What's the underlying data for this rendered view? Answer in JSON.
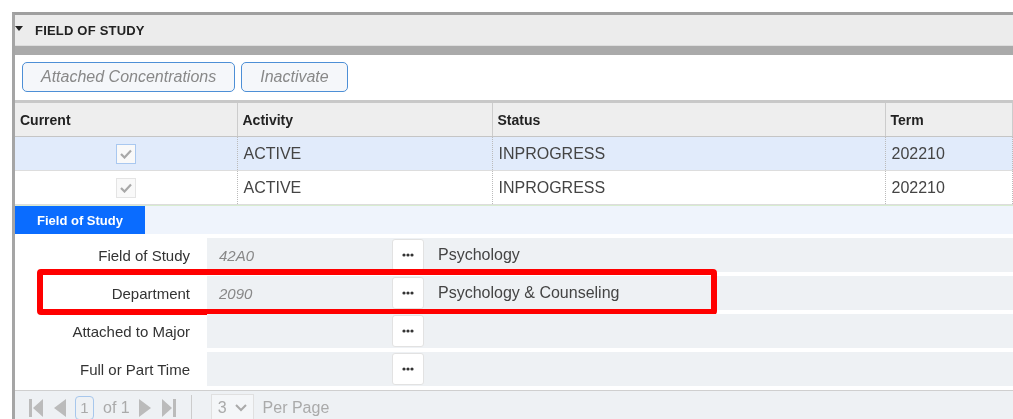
{
  "section": {
    "title": "FIELD OF STUDY",
    "expanded": true
  },
  "buttons": [
    {
      "label": "Attached Concentrations",
      "disabled": true
    },
    {
      "label": "Inactivate",
      "disabled": true
    }
  ],
  "table": {
    "columns": [
      "Current",
      "Activity",
      "Status",
      "Term"
    ],
    "rows": [
      {
        "selected": true,
        "current": true,
        "activity": "ACTIVE",
        "status": "INPROGRESS",
        "term": "202210"
      },
      {
        "selected": false,
        "current": true,
        "activity": "ACTIVE",
        "status": "INPROGRESS",
        "term": "202210"
      }
    ]
  },
  "tabs": [
    {
      "label": "Field of Study",
      "selected": true
    }
  ],
  "fields": [
    {
      "label": "Field of Study",
      "code": "42A0",
      "description": "Psychology",
      "highlighted": false
    },
    {
      "label": "Department",
      "code": "2090",
      "description": "Psychology & Counseling",
      "highlighted": true
    },
    {
      "label": "Attached to Major",
      "highlighted": false
    },
    {
      "label": "Full or Part Time",
      "highlighted": false
    }
  ],
  "pager": {
    "page": "1",
    "of": "of 1",
    "per_page": "3",
    "per_page_label": "Per Page"
  }
}
